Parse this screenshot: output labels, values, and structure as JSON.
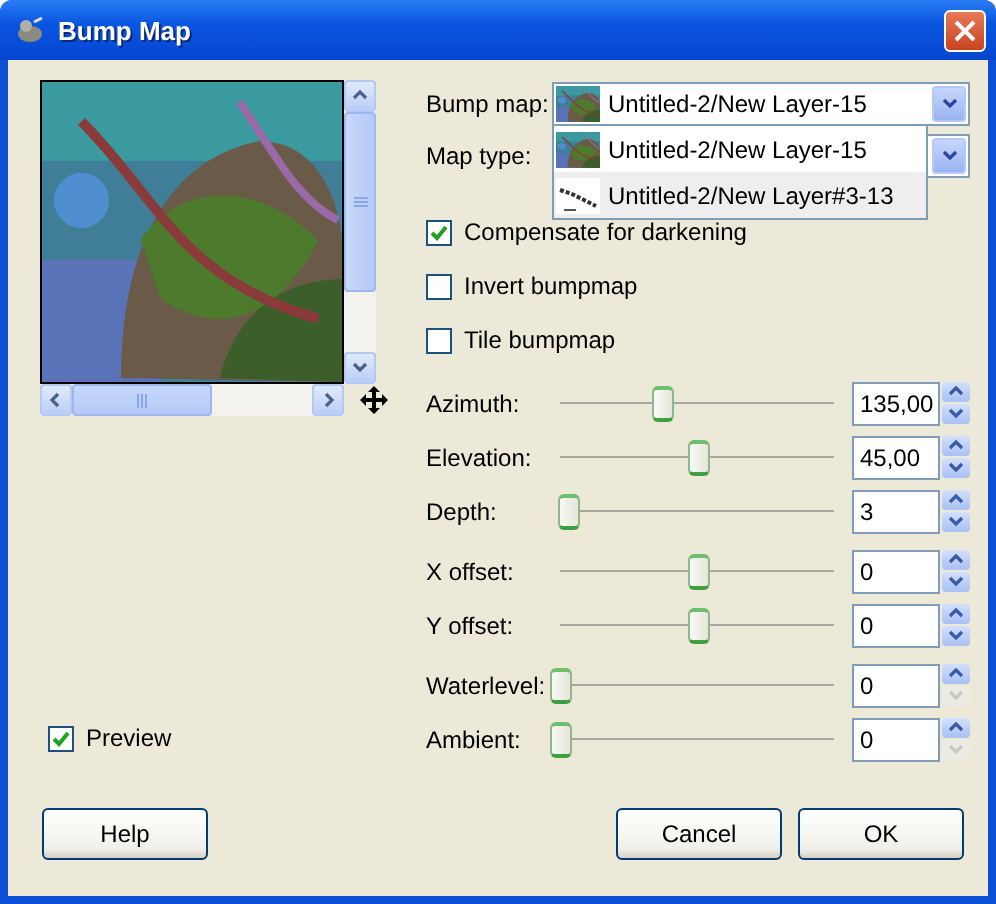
{
  "window": {
    "title": "Bump Map"
  },
  "preview": {
    "kind": "picture",
    "checkbox": {
      "label": "Preview",
      "checked": true
    }
  },
  "bump_map": {
    "label": "Bump map:",
    "value": "Untitled-2/New Layer-15",
    "options": [
      {
        "label": "Untitled-2/New Layer-15",
        "highlighted": false
      },
      {
        "label": "Untitled-2/New Layer#3-13",
        "kind": "sketch",
        "highlighted": true
      }
    ]
  },
  "map_type": {
    "label": "Map type:"
  },
  "checkboxes": [
    {
      "label": "Compensate for darkening",
      "checked": true
    },
    {
      "label": "Invert bumpmap",
      "checked": false
    },
    {
      "label": "Tile bumpmap",
      "checked": false
    }
  ],
  "slider_groups": [
    [
      {
        "label": "Azimuth:",
        "level": 0.37,
        "value": "135,00",
        "at_minimum": false
      },
      {
        "label": "Elevation:",
        "level": 0.5,
        "value": "45,00",
        "at_minimum": false
      },
      {
        "label": "Depth:",
        "level": 0.03,
        "value": "3",
        "at_minimum": false
      }
    ],
    [
      {
        "label": "X offset:",
        "level": 0.5,
        "value": "0",
        "at_minimum": false
      },
      {
        "label": "Y offset:",
        "level": 0.5,
        "value": "0",
        "at_minimum": false
      }
    ],
    [
      {
        "label": "Waterlevel:",
        "level": 0,
        "value": "0",
        "at_minimum": true
      },
      {
        "label": "Ambient:",
        "level": 0,
        "value": "0",
        "at_minimum": true
      }
    ]
  ],
  "buttons": [
    {
      "label": "Help"
    },
    {
      "label": "Cancel"
    },
    {
      "label": "OK"
    }
  ]
}
